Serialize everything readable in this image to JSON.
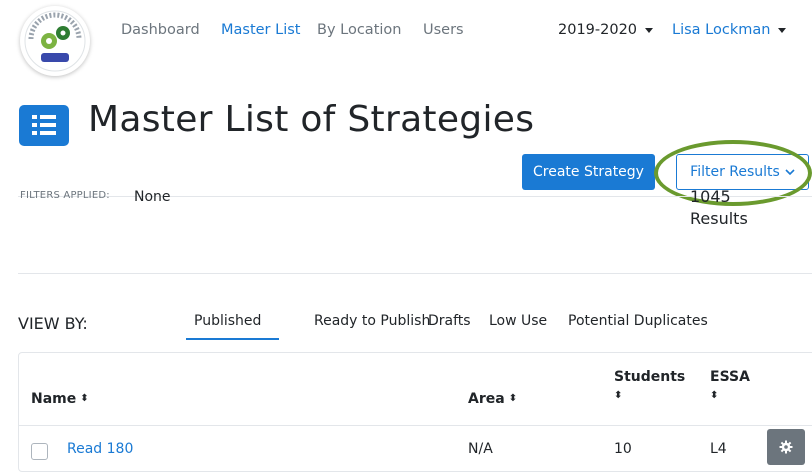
{
  "nav": {
    "logo_alt": "MiStrategyBank",
    "links": [
      "Dashboard",
      "Master List",
      "By Location",
      "Users"
    ],
    "year": "2019-2020",
    "user": "Lisa Lockman"
  },
  "header": {
    "title": "Master List of Strategies",
    "create_label": "Create Strategy",
    "filter_label": "Filter Results"
  },
  "filters": {
    "label": "FILTERS APPLIED:",
    "value": "None",
    "results_count": "1045",
    "results_label": "Results"
  },
  "view": {
    "label": "VIEW BY:",
    "tabs": [
      "Published",
      "Ready to Publish",
      "Drafts",
      "Low Use",
      "Potential Duplicates"
    ]
  },
  "table": {
    "columns": [
      "Name",
      "Area",
      "Students",
      "ESSA"
    ],
    "rows": [
      {
        "name": "Read 180",
        "area": "N/A",
        "students": "10",
        "essa": "L4"
      }
    ]
  },
  "colors": {
    "accent": "#1a7ad4",
    "annotation": "#6a9a2e",
    "gear_button": "#6c757d"
  }
}
